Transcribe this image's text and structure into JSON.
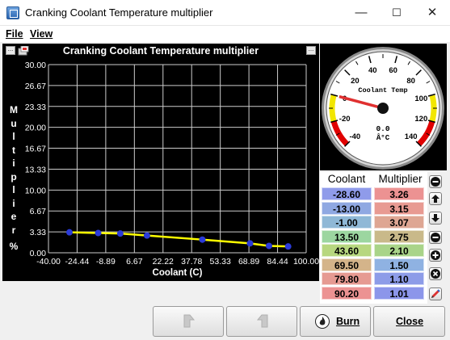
{
  "window": {
    "title": "Cranking Coolant Temperature multiplier",
    "minimize": "—",
    "maximize": "☐",
    "close": "✕"
  },
  "menu": {
    "file": "File",
    "view": "View"
  },
  "chart": {
    "title": "Cranking Coolant Temperature multiplier",
    "more_left": "...",
    "more_right": "..."
  },
  "chart_data": {
    "type": "line",
    "title": "Cranking Coolant Temperature multiplier",
    "xlabel": "Coolant (C)",
    "ylabel": "Multiplier %",
    "xlim": [
      -40.0,
      100.0
    ],
    "ylim": [
      0.0,
      30.0
    ],
    "x_ticks": [
      "-40.00",
      "-24.44",
      "-8.89",
      "6.67",
      "22.22",
      "37.78",
      "53.33",
      "68.89",
      "84.44",
      "100.00"
    ],
    "y_ticks": [
      "30.00",
      "26.67",
      "23.33",
      "20.00",
      "16.67",
      "13.33",
      "10.00",
      "6.67",
      "3.33",
      "0.00"
    ],
    "series": [
      {
        "x": [
          -28.6,
          -13.0,
          -1.0,
          13.5,
          43.6,
          69.5,
          79.8,
          90.2
        ],
        "values": [
          3.26,
          3.15,
          3.07,
          2.75,
          2.1,
          1.5,
          1.1,
          1.01
        ]
      }
    ],
    "grid": true,
    "colors": {
      "line": "#ffff00",
      "points": "#2b3bd9",
      "grid": "#cccccc",
      "background": "#000000"
    }
  },
  "gauge": {
    "label": "Coolant Temp",
    "value": "0.0",
    "unit": "Â°C",
    "ticks": [
      "-40",
      "-20",
      "0",
      "20",
      "40",
      "60",
      "80",
      "100",
      "120",
      "140"
    ]
  },
  "table": {
    "headers": [
      "Coolant",
      "Multiplier"
    ],
    "rows": [
      [
        "-28.60",
        "3.26"
      ],
      [
        "-13.00",
        "3.15"
      ],
      [
        "-1.00",
        "3.07"
      ],
      [
        "13.50",
        "2.75"
      ],
      [
        "43.60",
        "2.10"
      ],
      [
        "69.50",
        "1.50"
      ],
      [
        "79.80",
        "1.10"
      ],
      [
        "90.20",
        "1.01"
      ]
    ],
    "coolant_colors": [
      "#8f9bea",
      "#8fa8e2",
      "#8fb8d6",
      "#9cd6a0",
      "#b7d77f",
      "#d4b48a",
      "#e69a92",
      "#ec9292"
    ],
    "multiplier_colors": [
      "#ec9292",
      "#e89a92",
      "#dea693",
      "#c9b98a",
      "#a9d489",
      "#8fb2e2",
      "#8d9ce8",
      "#8c96ea"
    ]
  },
  "buttons": {
    "undo": "",
    "redo": "",
    "burn": "Burn",
    "close": "Close"
  }
}
